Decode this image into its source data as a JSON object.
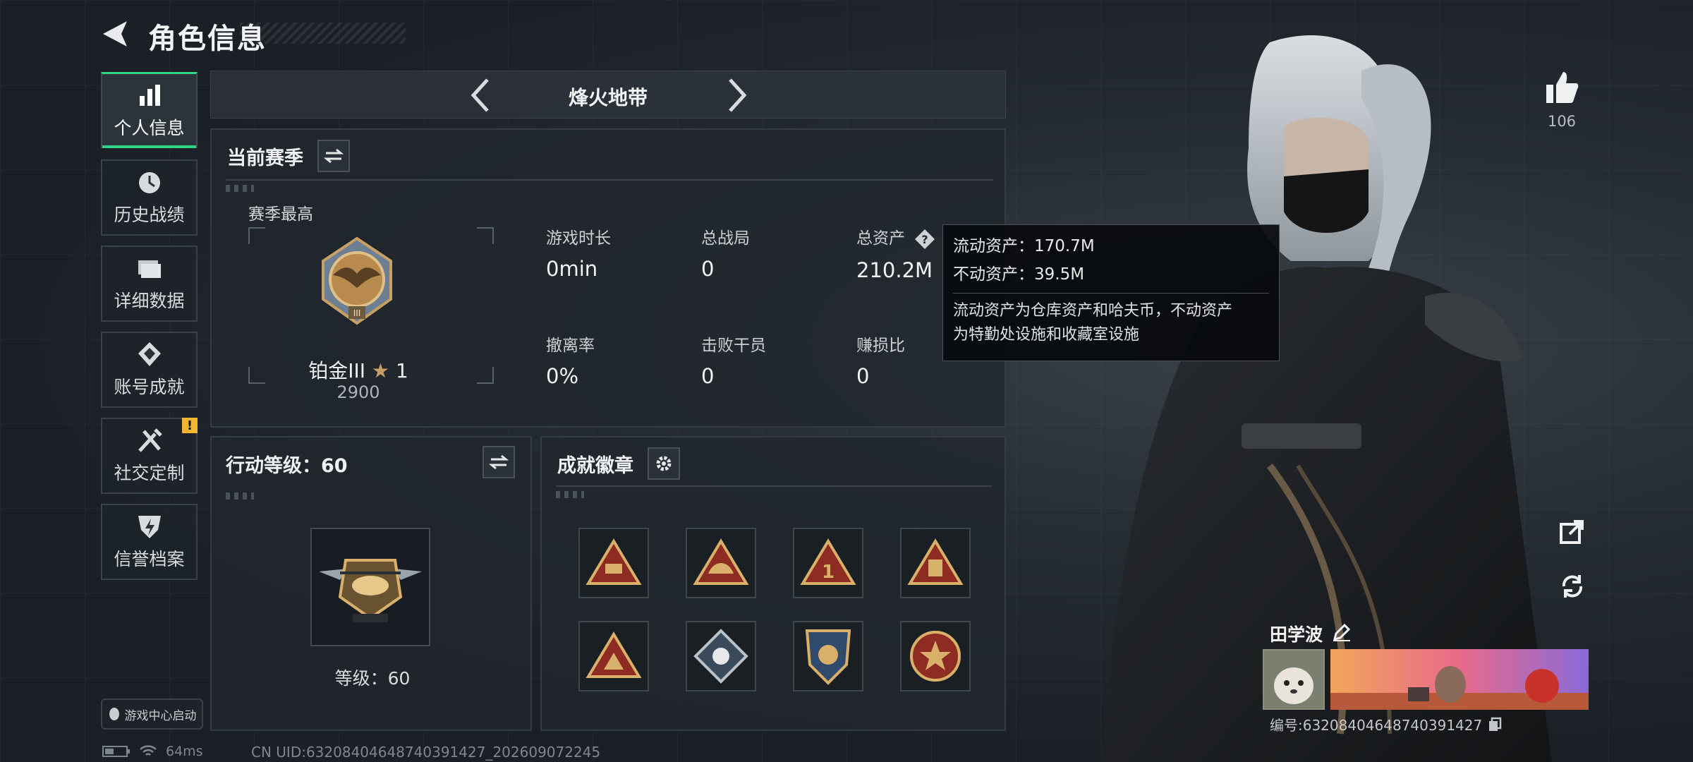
{
  "header": {
    "title": "角色信息"
  },
  "nav": {
    "items": [
      {
        "label": "个人信息",
        "icon": "bar-chart-icon"
      },
      {
        "label": "历史战绩",
        "icon": "clock-icon"
      },
      {
        "label": "详细数据",
        "icon": "folder-icon"
      },
      {
        "label": "账号成就",
        "icon": "medal-icon"
      },
      {
        "label": "社交定制",
        "icon": "tools-icon",
        "badge": "!"
      },
      {
        "label": "信誉档案",
        "icon": "shield-bolt-icon"
      }
    ],
    "game_center_label": "游戏中心启动"
  },
  "mode": {
    "title": "烽火地带"
  },
  "season": {
    "title": "当前赛季",
    "best_label": "赛季最高",
    "rank_name": "铂金III",
    "rank_stars": "1",
    "rank_score": "2900",
    "stats": [
      {
        "label": "游戏时长",
        "value": "0min"
      },
      {
        "label": "总战局",
        "value": "0"
      },
      {
        "label": "总资产",
        "value": "210.2M"
      },
      {
        "label": "撤离率",
        "value": "0%"
      },
      {
        "label": "击败干员",
        "value": "0"
      },
      {
        "label": "赚损比",
        "value": "0"
      }
    ]
  },
  "tooltip": {
    "liquid": "流动资产：170.7M",
    "fixed": "不动资产：39.5M",
    "desc_1": "流动资产为仓库资产和哈夫币，不动资产",
    "desc_2": "为特勤处设施和收藏室设施"
  },
  "level": {
    "title": "行动等级：60",
    "level_text": "等级：60"
  },
  "achievements": {
    "title": "成就徽章",
    "badges": [
      "triangle-badge-1",
      "triangle-badge-2",
      "triangle-badge-3",
      "triangle-badge-4",
      "triangle-badge-5",
      "diamond-badge",
      "shield-badge",
      "round-badge"
    ]
  },
  "profile": {
    "likes": "106",
    "name": "田学波",
    "id_line": "编号:632084046487403914​27"
  },
  "status": {
    "ping": "64ms",
    "uid_footer": "CN UID:632084046487403914​27_202609072245"
  },
  "colors": {
    "accent": "#2fd38a",
    "warn": "#f2b632",
    "gold": "#c8a064",
    "badge_red": "#8e2b22"
  }
}
